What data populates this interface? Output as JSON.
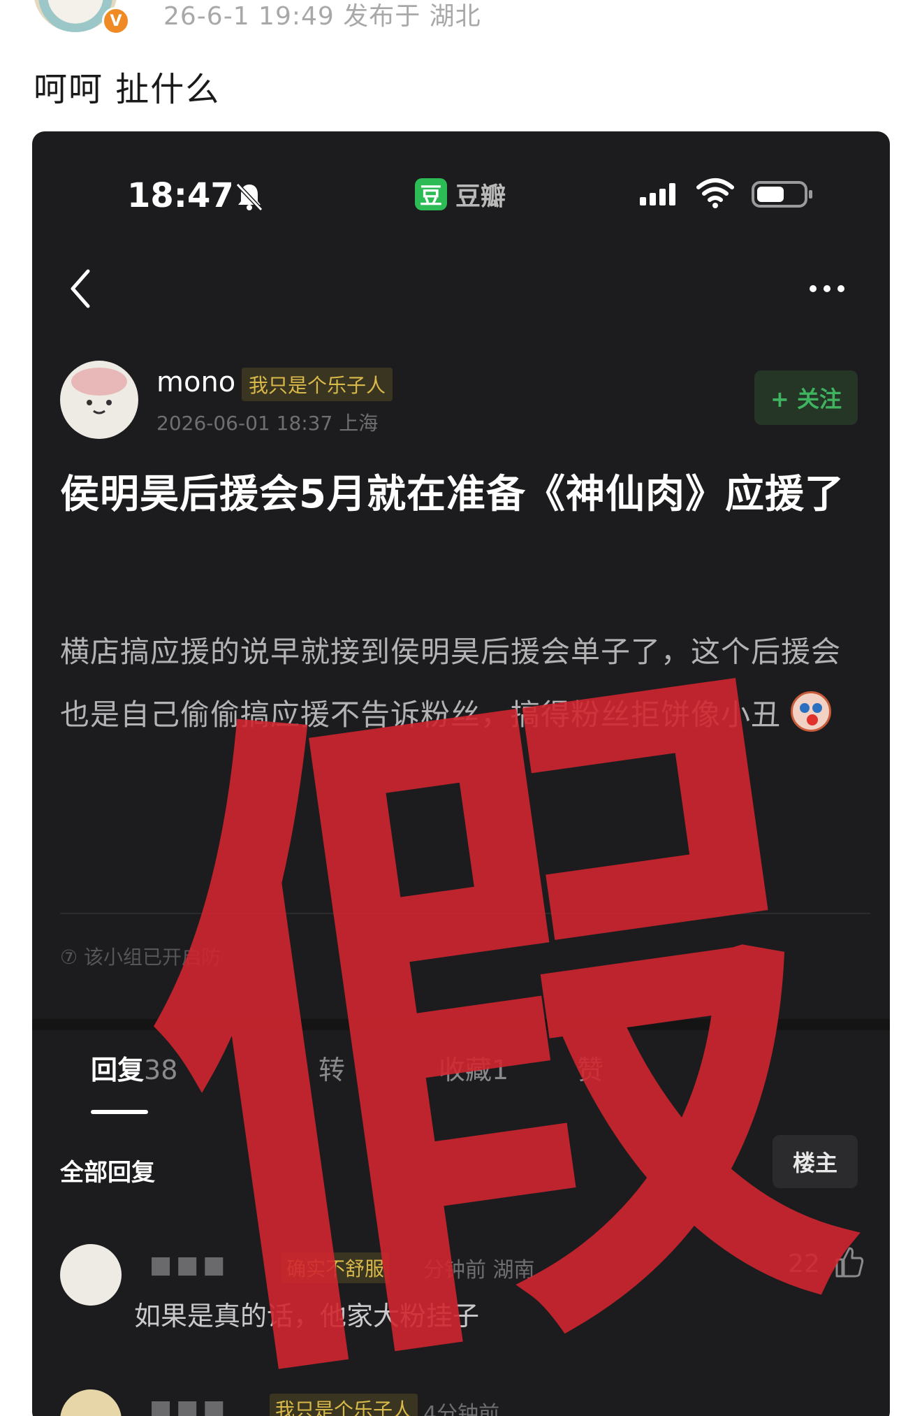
{
  "post": {
    "meta": "26-6-1 19:49  发布于 湖北",
    "verified_badge": "V",
    "text": "呵呵 扯什么"
  },
  "screenshot": {
    "status_time": "18:47",
    "app_mark": "豆",
    "app_name": "豆瓣",
    "author": {
      "name": "mono",
      "tag": "我只是个乐子人",
      "time": "2026-06-01 18:37  上海",
      "follow_label": "+ 关注"
    },
    "title": "侯明昊后援会5月就在准备《神仙肉》应援了",
    "body": "横店搞应援的说早就接到侯明昊后援会单子了，这个后援会也是自己偷偷搞应援不告诉粉丝，搞得粉丝拒饼像小丑",
    "notice": "⑦ 该小组已开启防",
    "tabs": [
      {
        "label": "回复",
        "count": "38"
      },
      {
        "label": "转"
      },
      {
        "label": "收藏",
        "count": "1"
      },
      {
        "label": "赞"
      }
    ],
    "all_replies_label": "全部回复",
    "op_filter_label": "楼主",
    "replies": [
      {
        "name": "■■■",
        "tag": "确实不舒服",
        "meta": "分钟前  湖南",
        "text": "如果是真的话，他家大粉挂子",
        "likes": "22"
      },
      {
        "name": "■■■",
        "tag": "我只是个乐子人",
        "meta": "4分钟前",
        "text": ""
      }
    ],
    "stamp_text": "假",
    "colors": {
      "accent": "#2dbb55",
      "stamp": "#d0262f",
      "background": "#1c1c1e"
    }
  }
}
